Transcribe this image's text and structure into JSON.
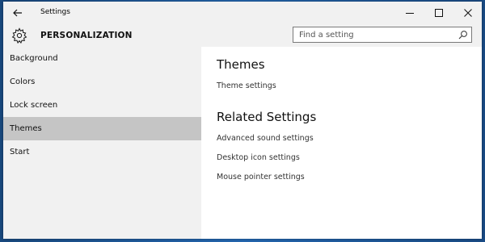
{
  "window": {
    "title": "Settings"
  },
  "header": {
    "section": "PERSONALIZATION",
    "search_placeholder": "Find a setting"
  },
  "sidebar": {
    "items": [
      {
        "label": "Background",
        "selected": false
      },
      {
        "label": "Colors",
        "selected": false
      },
      {
        "label": "Lock screen",
        "selected": false
      },
      {
        "label": "Themes",
        "selected": true
      },
      {
        "label": "Start",
        "selected": false
      }
    ]
  },
  "main": {
    "heading": "Themes",
    "theme_settings": "Theme settings",
    "related_heading": "Related Settings",
    "related_links": [
      "Advanced sound settings",
      "Desktop icon settings",
      "Mouse pointer settings"
    ]
  },
  "colors": {
    "sidebar_bg": "#f1f1f1",
    "selected_item_bg": "#c5c5c5",
    "desktop_blue": "#1f5a9a"
  },
  "icons": {
    "back": "back-arrow-icon",
    "settings": "gear-icon",
    "search": "search-icon",
    "minimize": "minimize-icon",
    "maximize": "maximize-icon",
    "close": "close-icon"
  }
}
